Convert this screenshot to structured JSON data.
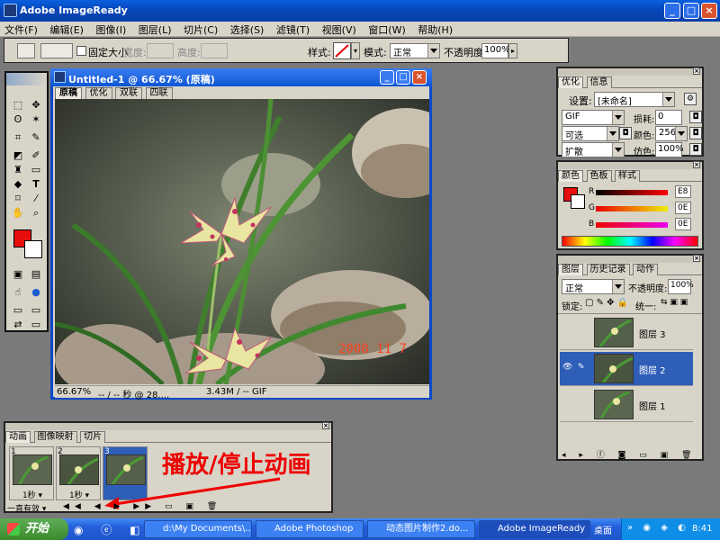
{
  "app": {
    "title": "Adobe ImageReady",
    "menu": [
      "文件(F)",
      "编辑(E)",
      "图像(I)",
      "图层(L)",
      "切片(C)",
      "选择(S)",
      "滤镜(T)",
      "视图(V)",
      "窗口(W)",
      "帮助(H)"
    ]
  },
  "options": {
    "fixed_size_label": "固定大小",
    "width_label": "宽度:",
    "height_label": "高度:",
    "style_label": "样式:",
    "mode_label": "模式:",
    "mode_value": "正常",
    "opacity_label": "不透明度:",
    "opacity_value": "100%"
  },
  "document": {
    "title": "Untitled-1 @ 66.67% (原稿)",
    "tabs": [
      "原稿",
      "优化",
      "双联",
      "四联"
    ],
    "date_stamp": "2008 11  7",
    "status_zoom": "66.67%",
    "status_time": "-- / -- 秒 @ 28....",
    "status_size": "3.43M / -- GIF"
  },
  "optimize_panel": {
    "tabs": [
      "优化",
      "信息"
    ],
    "settings_label": "设置:",
    "settings_value": "[未命名]",
    "format_value": "GIF",
    "lossy_label": "损耗:",
    "lossy_value": "0",
    "palette_value": "可选",
    "colors_label": "颜色:",
    "colors_value": "256",
    "dither_value": "扩散",
    "dither_label": "仿色:",
    "dither_amount": "100%"
  },
  "color_panel": {
    "tabs": [
      "颜色",
      "色板",
      "样式"
    ],
    "r_label": "R",
    "g_label": "G",
    "b_label": "B",
    "r_value": "E8",
    "g_value": "0E",
    "b_value": "0E"
  },
  "layers_panel": {
    "tabs": [
      "图层",
      "历史记录",
      "动作"
    ],
    "blend_value": "正常",
    "opacity_label": "不透明度:",
    "opacity_value": "100%",
    "lock_label": "锁定:",
    "unify_label": "统一:",
    "layers": [
      {
        "name": "图层 3",
        "selected": false,
        "visible": false
      },
      {
        "name": "图层 2",
        "selected": true,
        "visible": true
      },
      {
        "name": "图层 1",
        "selected": false,
        "visible": false
      }
    ]
  },
  "animation_panel": {
    "tabs": [
      "动画",
      "图像映射",
      "切片"
    ],
    "frames": [
      {
        "num": "1",
        "delay": "1秒 ▾"
      },
      {
        "num": "2",
        "delay": "1秒 ▾"
      },
      {
        "num": "3",
        "delay": ""
      }
    ],
    "loop_value": "一直有效",
    "annotation": "播放/停止动画"
  },
  "colors": {
    "foreground": "#e80e0e",
    "background": "#ffffff",
    "accent": "#2f5eb8"
  },
  "taskbar": {
    "start_label": "开始",
    "tasks": [
      "d:\\My Documents\\...",
      "Adobe Photoshop",
      "动态图片制作2.do...",
      "Adobe ImageReady"
    ],
    "desktop_label": "桌面",
    "clock": "8:41"
  }
}
